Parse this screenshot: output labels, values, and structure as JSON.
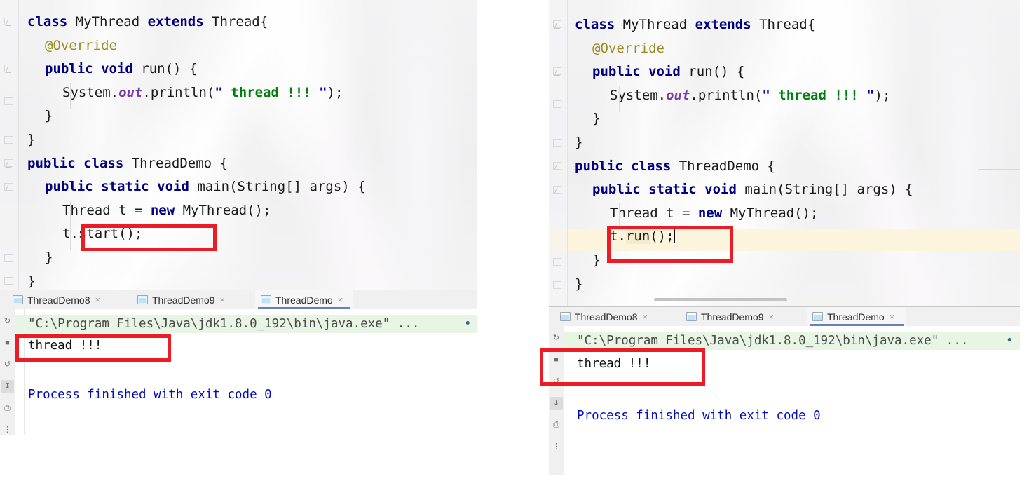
{
  "panels": [
    {
      "id": "left",
      "label": "start-example",
      "editor": {
        "lines": [
          {
            "indent": 0,
            "tokens": [
              {
                "t": "class ",
                "c": "kw"
              },
              {
                "t": "MyThread ",
                "c": "plain"
              },
              {
                "t": "extends ",
                "c": "kw"
              },
              {
                "t": "Thread{",
                "c": "plain"
              }
            ]
          },
          {
            "indent": 1,
            "tokens": [
              {
                "t": "@Override",
                "c": "anno"
              }
            ]
          },
          {
            "indent": 1,
            "tokens": [
              {
                "t": "public ",
                "c": "kw"
              },
              {
                "t": "void ",
                "c": "kw"
              },
              {
                "t": "run() {",
                "c": "plain"
              }
            ]
          },
          {
            "indent": 2,
            "tokens": [
              {
                "t": "System.",
                "c": "plain"
              },
              {
                "t": "out",
                "c": "fld"
              },
              {
                "t": ".println(",
                "c": "plain"
              },
              {
                "t": "\"",
                "c": "quo"
              },
              {
                "t": " thread !!! ",
                "c": "str"
              },
              {
                "t": "\"",
                "c": "quo"
              },
              {
                "t": ");",
                "c": "plain"
              }
            ]
          },
          {
            "indent": 1,
            "tokens": [
              {
                "t": "}",
                "c": "plain"
              }
            ]
          },
          {
            "indent": 0,
            "tokens": [
              {
                "t": "}",
                "c": "plain"
              }
            ]
          },
          {
            "indent": 0,
            "tokens": [
              {
                "t": "public ",
                "c": "kw"
              },
              {
                "t": "class ",
                "c": "kw"
              },
              {
                "t": "ThreadDemo {",
                "c": "plain"
              }
            ]
          },
          {
            "indent": 1,
            "tokens": [
              {
                "t": "public ",
                "c": "kw"
              },
              {
                "t": "static ",
                "c": "kw"
              },
              {
                "t": "void ",
                "c": "kw"
              },
              {
                "t": "main(String[] args) {",
                "c": "plain"
              }
            ]
          },
          {
            "indent": 2,
            "tokens": [
              {
                "t": "Thread t = ",
                "c": "plain"
              },
              {
                "t": "new ",
                "c": "kw"
              },
              {
                "t": "MyThread();",
                "c": "plain"
              }
            ]
          },
          {
            "indent": 2,
            "tokens": [
              {
                "t": "t.start();",
                "c": "plain"
              }
            ]
          },
          {
            "indent": 1,
            "tokens": [
              {
                "t": "}",
                "c": "plain"
              }
            ]
          },
          {
            "indent": 0,
            "tokens": [
              {
                "t": "}",
                "c": "plain"
              }
            ]
          }
        ],
        "highlighted_line_index": null,
        "highlight_label": ""
      },
      "run_window": {
        "tabs": [
          {
            "label": "ThreadDemo8",
            "active": false,
            "close": "×"
          },
          {
            "label": "ThreadDemo9",
            "active": false,
            "close": "×"
          },
          {
            "label": "ThreadDemo",
            "active": true,
            "close": "×"
          }
        ],
        "console": {
          "command": "\"C:\\Program Files\\Java\\jdk1.8.0_192\\bin\\java.exe\" ...",
          "output": "thread !!!",
          "exit_line": "Process finished with exit code 0"
        },
        "side_buttons": [
          "rerun-icon",
          "stop-icon",
          "rotate-icon",
          "scroll-to-end-icon",
          "print-icon",
          "more-icon"
        ]
      },
      "annotation_boxes": [
        "highlighted-call-box",
        "console-output-box"
      ]
    },
    {
      "id": "right",
      "label": "run-example",
      "editor": {
        "lines": [
          {
            "indent": 0,
            "tokens": [
              {
                "t": "class ",
                "c": "kw"
              },
              {
                "t": "MyThread ",
                "c": "plain"
              },
              {
                "t": "extends ",
                "c": "kw"
              },
              {
                "t": "Thread{",
                "c": "plain"
              }
            ]
          },
          {
            "indent": 1,
            "tokens": [
              {
                "t": "@Override",
                "c": "anno"
              }
            ]
          },
          {
            "indent": 1,
            "tokens": [
              {
                "t": "public ",
                "c": "kw"
              },
              {
                "t": "void ",
                "c": "kw"
              },
              {
                "t": "run() {",
                "c": "plain"
              }
            ]
          },
          {
            "indent": 2,
            "tokens": [
              {
                "t": "System.",
                "c": "plain"
              },
              {
                "t": "out",
                "c": "fld"
              },
              {
                "t": ".println(",
                "c": "plain"
              },
              {
                "t": "\"",
                "c": "quo"
              },
              {
                "t": " thread !!! ",
                "c": "str"
              },
              {
                "t": "\"",
                "c": "quo"
              },
              {
                "t": ");",
                "c": "plain"
              }
            ]
          },
          {
            "indent": 1,
            "tokens": [
              {
                "t": "}",
                "c": "plain"
              }
            ]
          },
          {
            "indent": 0,
            "tokens": [
              {
                "t": "}",
                "c": "plain"
              }
            ]
          },
          {
            "indent": 0,
            "tokens": [
              {
                "t": "public ",
                "c": "kw"
              },
              {
                "t": "class ",
                "c": "kw"
              },
              {
                "t": "ThreadDemo {",
                "c": "plain"
              }
            ]
          },
          {
            "indent": 1,
            "tokens": [
              {
                "t": "public ",
                "c": "kw"
              },
              {
                "t": "static ",
                "c": "kw"
              },
              {
                "t": "void ",
                "c": "kw"
              },
              {
                "t": "main(String[] args) {",
                "c": "plain"
              }
            ]
          },
          {
            "indent": 2,
            "tokens": [
              {
                "t": "Thread t = ",
                "c": "plain"
              },
              {
                "t": "new ",
                "c": "kw"
              },
              {
                "t": "MyThread();",
                "c": "plain"
              }
            ]
          },
          {
            "indent": 2,
            "tokens": [
              {
                "t": "t.",
                "c": "plain"
              },
              {
                "t": "run",
                "c": "plain",
                "hl": true
              },
              {
                "t": "();",
                "c": "plain"
              },
              {
                "t": "",
                "c": "caret"
              }
            ]
          },
          {
            "indent": 1,
            "tokens": [
              {
                "t": "}",
                "c": "plain"
              }
            ]
          },
          {
            "indent": 0,
            "tokens": [
              {
                "t": "}",
                "c": "plain"
              }
            ]
          }
        ],
        "highlighted_line_index": 9,
        "highlight_label": "caret-line-highlight"
      },
      "run_window": {
        "tabs": [
          {
            "label": "ThreadDemo8",
            "active": false,
            "close": "×"
          },
          {
            "label": "ThreadDemo9",
            "active": false,
            "close": "×"
          },
          {
            "label": "ThreadDemo",
            "active": true,
            "close": "×"
          }
        ],
        "console": {
          "command": "\"C:\\Program Files\\Java\\jdk1.8.0_192\\bin\\java.exe\" ...",
          "output": "thread !!!",
          "exit_line": "Process finished with exit code 0"
        },
        "side_buttons": [
          "rerun-icon",
          "stop-icon",
          "rotate-icon",
          "scroll-to-end-icon",
          "print-icon",
          "more-icon"
        ]
      },
      "annotation_boxes": [
        "highlighted-call-box",
        "console-output-box"
      ]
    }
  ],
  "colors": {
    "keyword": "#000080",
    "annotation": "#9b8c1f",
    "string": "#007f0e",
    "field": "#7a3aa8",
    "console_blue": "#000cc0",
    "annotation_red": "#ec1c24",
    "command_bg": "#e9f5e4",
    "caret_line_bg": "#fcf4dc",
    "tab_underline": "#4b6eaf"
  },
  "console_dots": "• • •"
}
